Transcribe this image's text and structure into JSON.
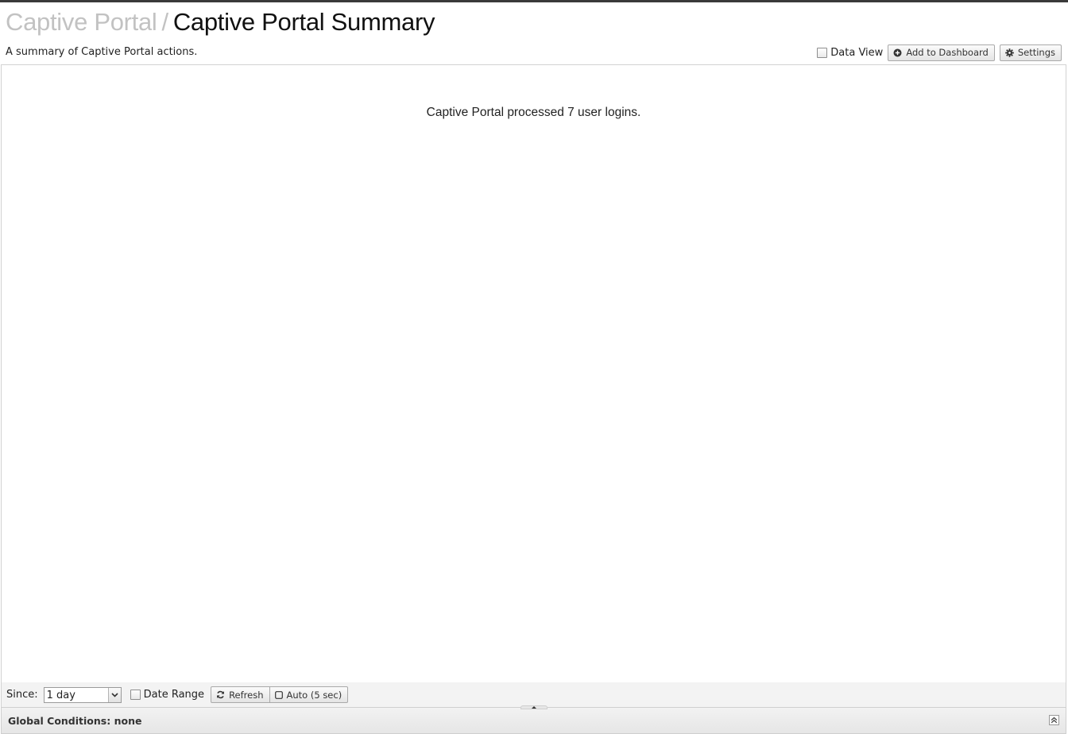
{
  "header": {
    "breadcrumb_parent": "Captive Portal",
    "breadcrumb_separator": "/",
    "title": "Captive Portal Summary",
    "description": "A summary of Captive Portal actions."
  },
  "toolbar": {
    "data_view_label": "Data View",
    "data_view_checked": false,
    "add_dashboard_label": "Add to Dashboard",
    "settings_label": "Settings"
  },
  "report": {
    "summary_text": "Captive Portal processed 7 user logins."
  },
  "footer": {
    "since_label": "Since:",
    "since_value": "1 day",
    "date_range_label": "Date Range",
    "date_range_checked": false,
    "refresh_label": "Refresh",
    "auto_label": "Auto (5 sec)"
  },
  "conditions": {
    "label": "Global Conditions: none"
  },
  "icons": {
    "add": "plus-circle-icon",
    "settings": "gear-icon",
    "refresh": "refresh-icon",
    "auto": "checkbox-icon",
    "dropdown": "chevron-down-icon",
    "collapse": "double-chevron-up-icon"
  }
}
